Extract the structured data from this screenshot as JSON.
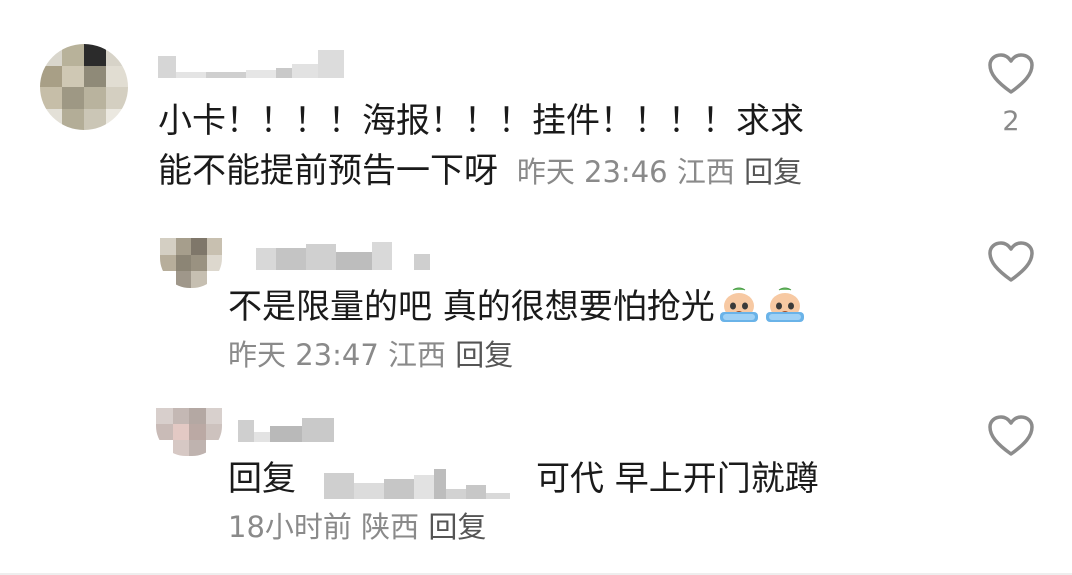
{
  "comments": [
    {
      "text_line1": "小卡！！！！海报！！！挂件！！！！求求",
      "text_line2": "能不能提前预告一下呀",
      "time": "昨天 23:46",
      "location": "江西",
      "reply_label": "回复",
      "like_count": "2",
      "avatar_icon": "pixelated-avatar",
      "like_icon": "heart-outline-icon"
    },
    {
      "text_line1": "不是限量的吧 真的很想要怕抢光",
      "emoji_icon": "crying-face-emoji",
      "time": "昨天 23:47",
      "location": "江西",
      "reply_label": "回复",
      "like_count": "",
      "avatar_icon": "pixelated-avatar",
      "like_icon": "heart-outline-icon"
    },
    {
      "reply_prefix": "回复",
      "text_line1": "可代 早上开门就蹲",
      "time": "18小时前",
      "location": "陕西",
      "reply_label": "回复",
      "like_count": "",
      "avatar_icon": "pixelated-avatar",
      "like_icon": "heart-outline-icon"
    }
  ],
  "colors": {
    "text": "#1a1a1a",
    "meta": "#8a8a8a",
    "heart_stroke": "#8c8c8c"
  }
}
